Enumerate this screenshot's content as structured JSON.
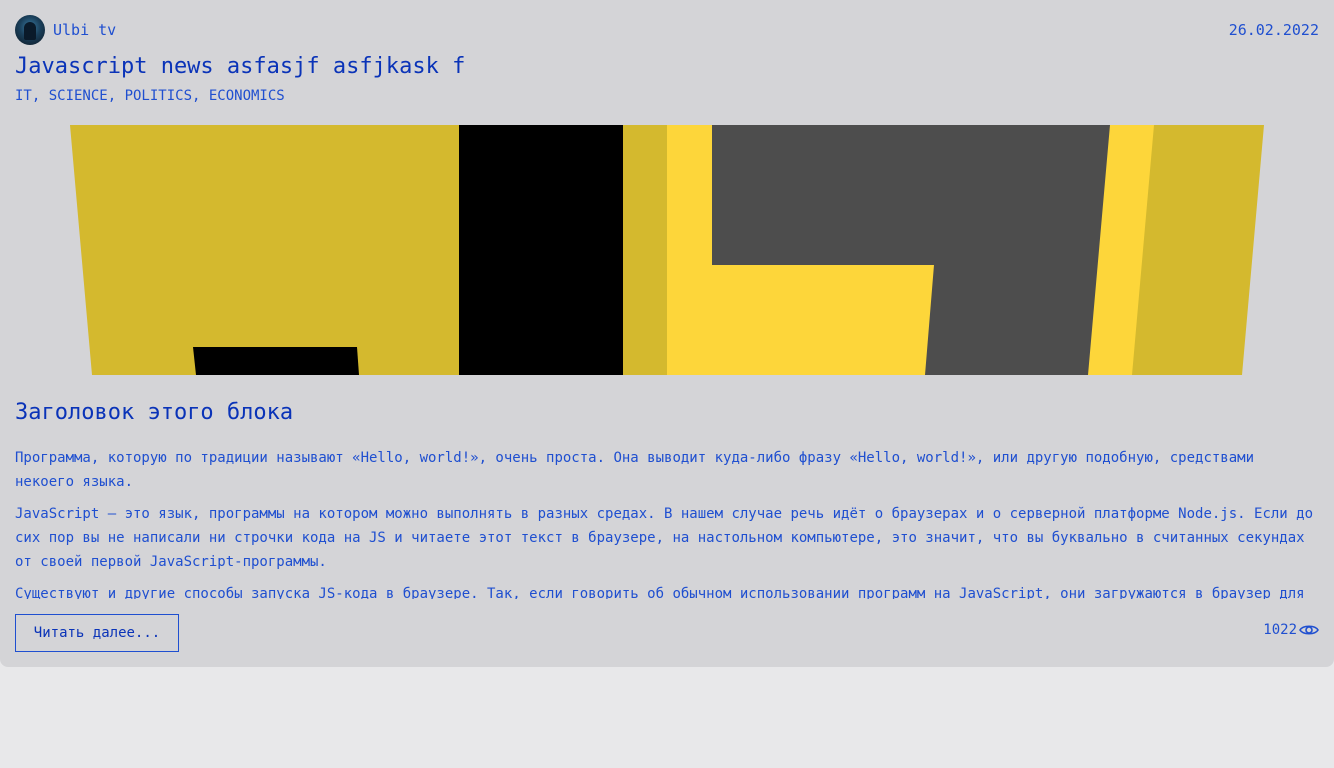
{
  "article": {
    "author": "Ulbi tv",
    "date": "26.02.2022",
    "title": "Javascript news asfasjf asfjkask f",
    "tags": "IT, SCIENCE, POLITICS, ECONOMICS",
    "image_colors": {
      "yellow_dark": "#d4b92e",
      "yellow_light": "#fdd63a",
      "black": "#000000",
      "gray": "#4d4d4d"
    },
    "block_title": "Заголовок этого блока",
    "paragraphs": [
      "Программа, которую по традиции называют «Hello, world!», очень проста. Она выводит куда-либо фразу «Hello, world!», или другую подобную, средствами некоего языка.",
      "JavaScript — это язык, программы на котором можно выполнять в разных средах. В нашем случае речь идёт о браузерах и о серверной платформе Node.js. Если до сих пор вы не написали ни строчки кода на JS и читаете этот текст в браузере, на настольном компьютере, это значит, что вы буквально в считанных секундах от своей первой JavaScript-программы.",
      "Существуют и другие способы запуска JS-кода в браузере. Так, если говорить об обычном использовании программ на JavaScript, они загружаются в браузер для обеспечения работы веб-страниц."
    ],
    "read_more_label": "Читать далее...",
    "views": "1022",
    "views_icon": "eye-icon",
    "accent_color": "#1f4fd0"
  }
}
